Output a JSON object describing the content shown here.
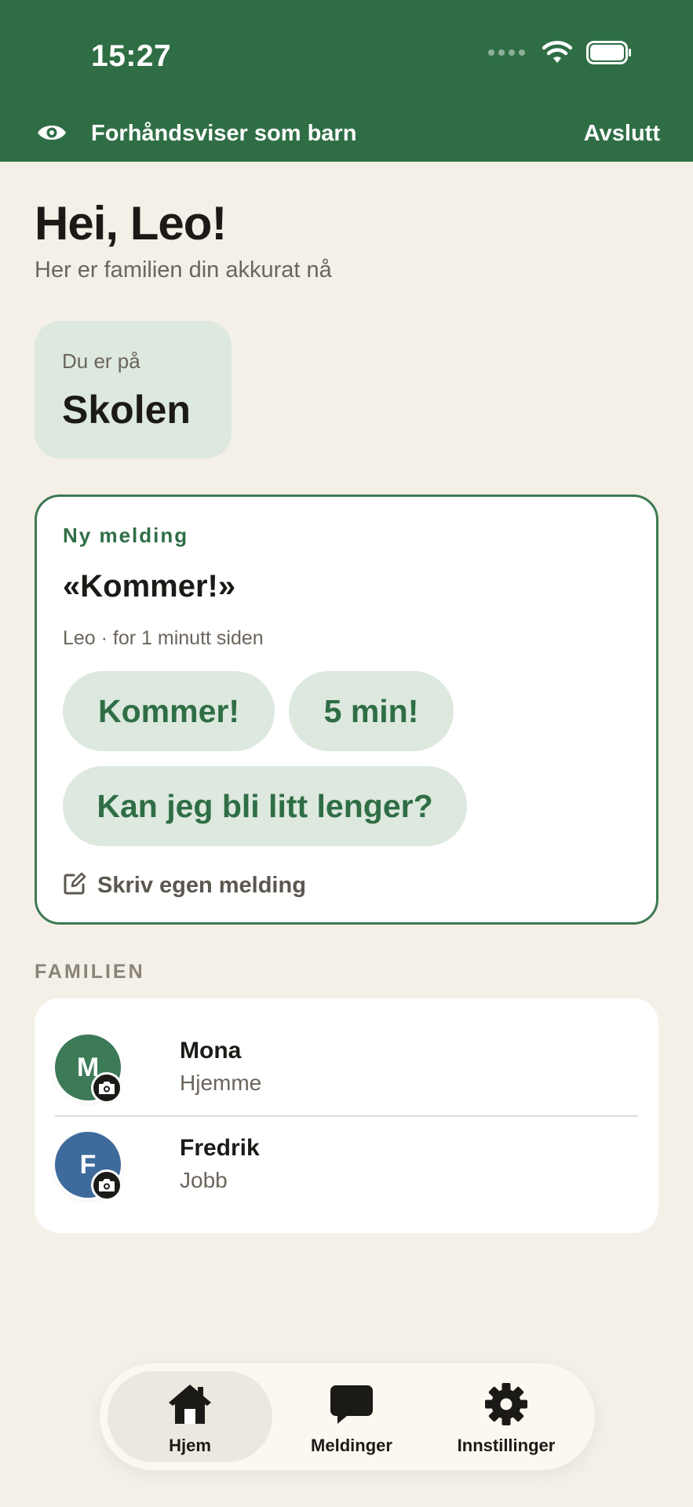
{
  "status_bar": {
    "time": "15:27"
  },
  "preview_banner": {
    "text": "Forhåndsviser som barn",
    "exit_label": "Avslutt"
  },
  "header": {
    "greeting": "Hei, Leo!",
    "subtitle": "Her er familien din akkurat nå"
  },
  "location": {
    "label": "Du er på",
    "value": "Skolen"
  },
  "message": {
    "kicker": "Ny melding",
    "text": "«Kommer!»",
    "meta": "Leo · for 1 minutt siden",
    "quick_replies": [
      "Kommer!",
      "5 min!",
      "Kan jeg bli litt lenger?"
    ],
    "write_label": "Skriv egen melding"
  },
  "family": {
    "heading": "FAMILIEN",
    "members": [
      {
        "initial": "M",
        "name": "Mona",
        "place": "Hjemme",
        "color": "#3d7a57"
      },
      {
        "initial": "F",
        "name": "Fredrik",
        "place": "Jobb",
        "color": "#3f6a9c"
      }
    ]
  },
  "tabbar": {
    "tabs": [
      {
        "label": "Hjem",
        "icon": "home-icon",
        "active": true
      },
      {
        "label": "Meldinger",
        "icon": "chat-bubble-icon",
        "active": false
      },
      {
        "label": "Innstillinger",
        "icon": "gear-icon",
        "active": false
      }
    ]
  },
  "colors": {
    "brand": "#2f6e45",
    "background": "#f4f0e8",
    "chip": "#dde8df"
  }
}
